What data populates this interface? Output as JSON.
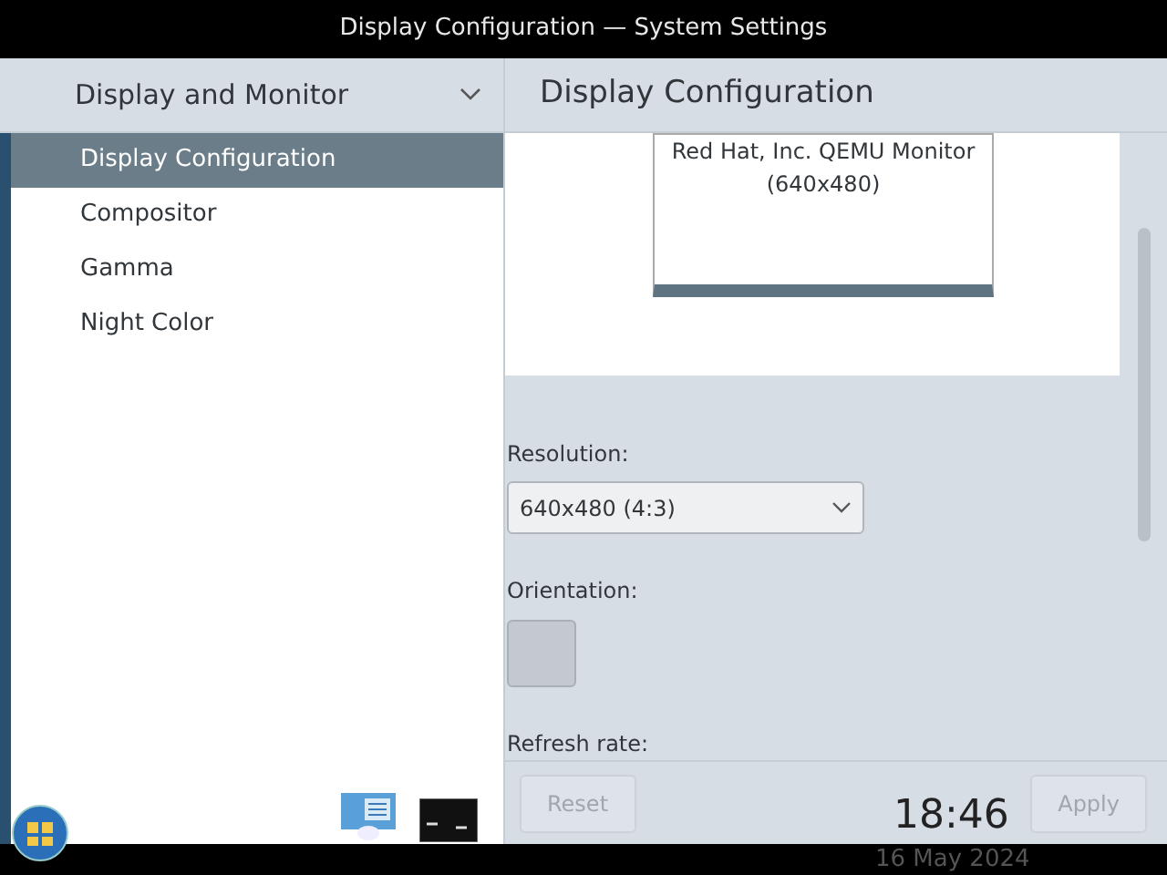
{
  "window": {
    "title": "Display Configuration — System Settings"
  },
  "sidebar": {
    "category": "Display and Monitor",
    "items": [
      {
        "label": "Display Configuration",
        "selected": true
      },
      {
        "label": "Compositor",
        "selected": false
      },
      {
        "label": "Gamma",
        "selected": false
      },
      {
        "label": "Night Color",
        "selected": false
      }
    ]
  },
  "page": {
    "title": "Display Configuration",
    "monitor": {
      "name": "Red Hat, Inc. QEMU Monitor",
      "resolution": "(640x480)"
    },
    "resolution": {
      "label": "Resolution:",
      "value": "640x480 (4:3)"
    },
    "orientation": {
      "label": "Orientation:"
    },
    "refresh_rate": {
      "label": "Refresh rate:"
    },
    "buttons": [
      {
        "label": "Reset",
        "disabled": true
      },
      {
        "label": "Apply",
        "disabled": true
      }
    ]
  },
  "clock": {
    "time": "18:46",
    "date": "16 May 2024"
  }
}
